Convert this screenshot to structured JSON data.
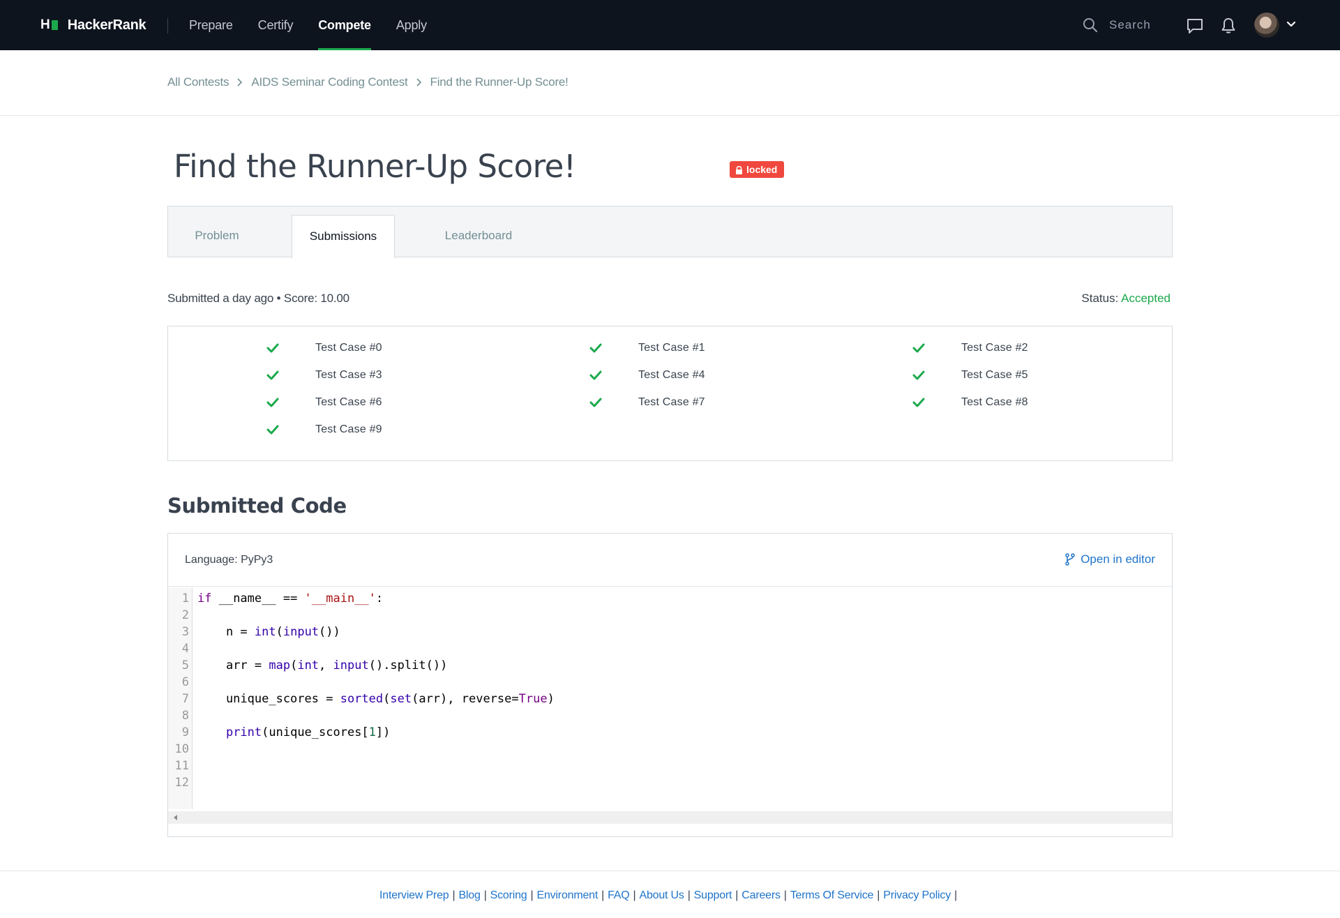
{
  "brand": {
    "logo_mark": "H",
    "name": "HackerRank"
  },
  "nav": {
    "items": [
      {
        "label": "Prepare",
        "active": false
      },
      {
        "label": "Certify",
        "active": false
      },
      {
        "label": "Compete",
        "active": true
      },
      {
        "label": "Apply",
        "active": false
      }
    ],
    "search_placeholder": "Search",
    "icons": [
      "search-icon",
      "chat-icon",
      "bell-icon",
      "avatar",
      "chevron-down-icon"
    ]
  },
  "breadcrumb": [
    "All Contests",
    "AIDS Seminar Coding Contest",
    "Find the Runner-Up Score!"
  ],
  "challenge": {
    "title": "Find the Runner-Up Score!",
    "badge": "locked"
  },
  "tabs": [
    {
      "label": "Problem",
      "active": false
    },
    {
      "label": "Submissions",
      "active": true
    },
    {
      "label": "Leaderboard",
      "active": false
    }
  ],
  "submission": {
    "meta": "Submitted a day ago • Score: 10.00",
    "status_label": "Status:",
    "status_value": "Accepted",
    "test_cases": [
      {
        "label": "Test Case #0",
        "passed": true
      },
      {
        "label": "Test Case #1",
        "passed": true
      },
      {
        "label": "Test Case #2",
        "passed": true
      },
      {
        "label": "Test Case #3",
        "passed": true
      },
      {
        "label": "Test Case #4",
        "passed": true
      },
      {
        "label": "Test Case #5",
        "passed": true
      },
      {
        "label": "Test Case #6",
        "passed": true
      },
      {
        "label": "Test Case #7",
        "passed": true
      },
      {
        "label": "Test Case #8",
        "passed": true
      },
      {
        "label": "Test Case #9",
        "passed": true
      }
    ]
  },
  "code": {
    "heading": "Submitted Code",
    "language": "Language: PyPy3",
    "open_editor": "Open in editor",
    "line_numbers": [
      "1",
      "2",
      "3",
      "4",
      "5",
      "6",
      "7",
      "8",
      "9",
      "10",
      "11",
      "12"
    ],
    "lines": [
      "if __name__ == '__main__':",
      "",
      "    n = int(input())",
      "",
      "    arr = map(int, input().split())",
      "",
      "    unique_scores = sorted(set(arr), reverse=True)",
      "",
      "    print(unique_scores[1])",
      "",
      "",
      ""
    ]
  },
  "footer": {
    "links": [
      "Interview Prep",
      "Blog",
      "Scoring",
      "Environment",
      "FAQ",
      "About Us",
      "Support",
      "Careers",
      "Terms Of Service",
      "Privacy Policy"
    ],
    "separator": "|"
  },
  "colors": {
    "nav_bg": "#0e141e",
    "accent_green": "#1ba94c",
    "locked_red": "#f0483e",
    "link_blue": "#1f74c9"
  }
}
